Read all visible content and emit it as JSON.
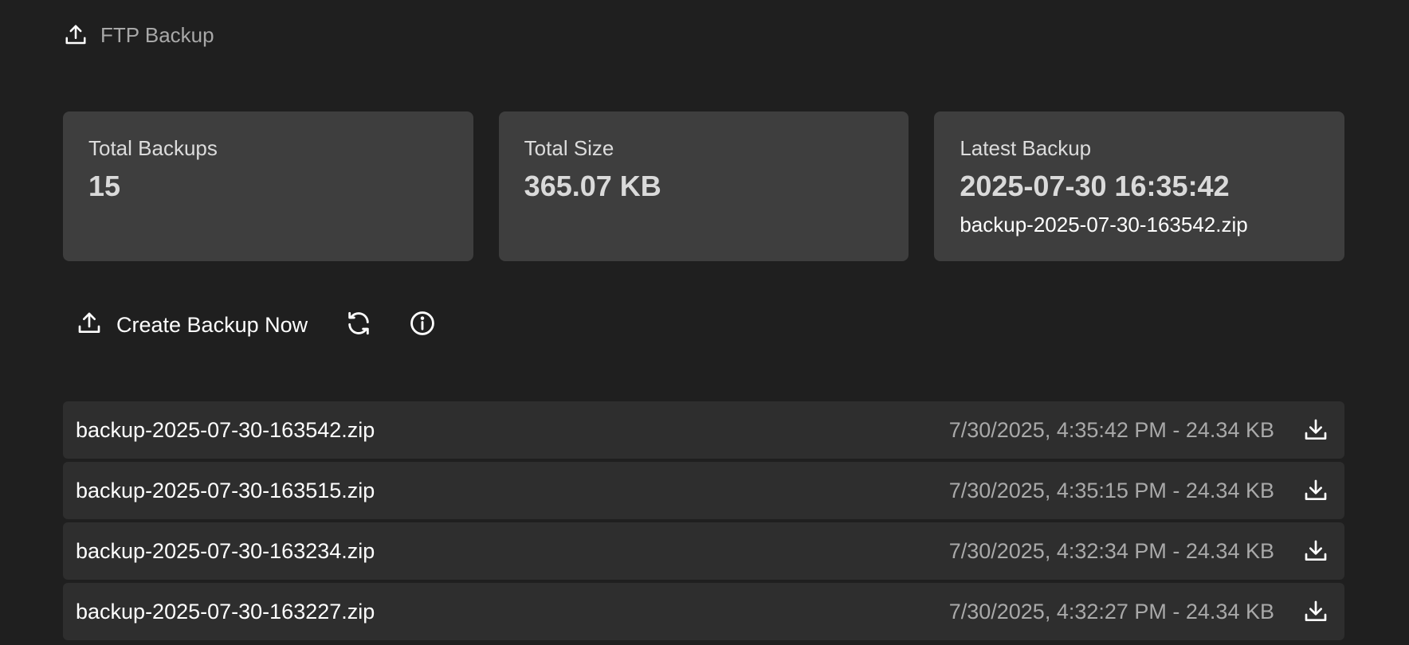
{
  "header": {
    "icon": "upload-icon",
    "title": "FTP Backup"
  },
  "stats": {
    "total_backups": {
      "label": "Total Backups",
      "value": "15"
    },
    "total_size": {
      "label": "Total Size",
      "value": "365.07 KB"
    },
    "latest_backup": {
      "label": "Latest Backup",
      "value": "2025-07-30 16:35:42",
      "filename": "backup-2025-07-30-163542.zip"
    }
  },
  "actions": {
    "create_label": "Create Backup Now",
    "create_icon": "upload-icon",
    "refresh_icon": "refresh-icon",
    "info_icon": "info-icon"
  },
  "backups": [
    {
      "name": "backup-2025-07-30-163542.zip",
      "meta": "7/30/2025, 4:35:42 PM - 24.34 KB",
      "icon": "download-icon"
    },
    {
      "name": "backup-2025-07-30-163515.zip",
      "meta": "7/30/2025, 4:35:15 PM - 24.34 KB",
      "icon": "download-icon"
    },
    {
      "name": "backup-2025-07-30-163234.zip",
      "meta": "7/30/2025, 4:32:34 PM - 24.34 KB",
      "icon": "download-icon"
    },
    {
      "name": "backup-2025-07-30-163227.zip",
      "meta": "7/30/2025, 4:32:27 PM - 24.34 KB",
      "icon": "download-icon"
    }
  ],
  "colors": {
    "background": "#1f1f1f",
    "card": "#3e3e3e",
    "row": "#2e2e2e",
    "muted_text": "#a9a9a9"
  }
}
